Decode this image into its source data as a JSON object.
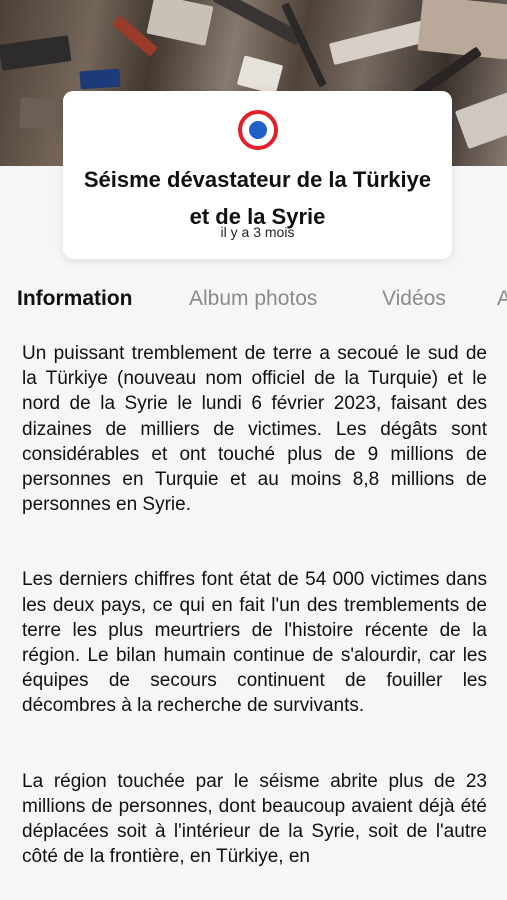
{
  "hero": {
    "image_alt": "earthquake-rubble-photo"
  },
  "card": {
    "icon": "french-roundel-icon",
    "title": "Séisme dévastateur de la Türkiye et de la Syrie",
    "time": "il y a 3 mois"
  },
  "tabs": [
    {
      "label": "Information",
      "active": true
    },
    {
      "label": "Album photos",
      "active": false
    },
    {
      "label": "Vidéos",
      "active": false
    },
    {
      "label": "A",
      "active": false
    }
  ],
  "article": {
    "paragraphs": [
      "Un puissant tremblement de terre a secoué le sud de la Türkiye (nouveau nom officiel de la Turquie) et le nord de la Syrie le lundi 6 février 2023, faisant des dizaines de milliers de victimes. Les dégâts sont considérables et ont touché plus de 9 millions de personnes en Turquie et au moins 8,8 millions de personnes en Syrie.",
      "Les derniers chiffres font état de 54 000 victimes dans les deux pays, ce qui en fait l'un des tremblements de terre les plus meurtriers de l'histoire récente de la région. Le bilan humain continue de s'alourdir, car les équipes de secours continuent de fouiller les décombres à la recherche de survivants.",
      "La région touchée par le séisme abrite plus de 23 millions de personnes, dont beaucoup avaient déjà été déplacées soit à l'intérieur de la Syrie, soit de l'autre côté de la frontière, en Türkiye, en"
    ]
  },
  "colors": {
    "roundel_outer": "#e1202a",
    "roundel_inner": "#1f5fc7",
    "active_tab": "#111111",
    "inactive_tab": "#8a8a8a"
  }
}
